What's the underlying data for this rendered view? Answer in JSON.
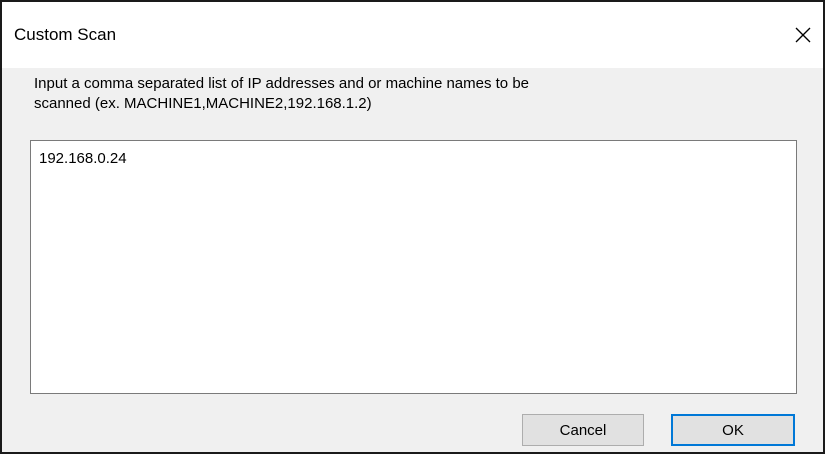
{
  "window": {
    "title": "Custom Scan",
    "close_icon": "close-icon"
  },
  "instructions": {
    "line1": "Input a comma separated list of IP addresses and or machine names to be",
    "line2": "scanned (ex. MACHINE1,MACHINE2,192.168.1.2)"
  },
  "targets_input": {
    "value": "192.168.0.24"
  },
  "buttons": {
    "cancel_label": "Cancel",
    "ok_label": "OK"
  },
  "colors": {
    "accent": "#0078d7",
    "dialog_background": "#f0f0f0",
    "titlebar_background": "#ffffff"
  }
}
